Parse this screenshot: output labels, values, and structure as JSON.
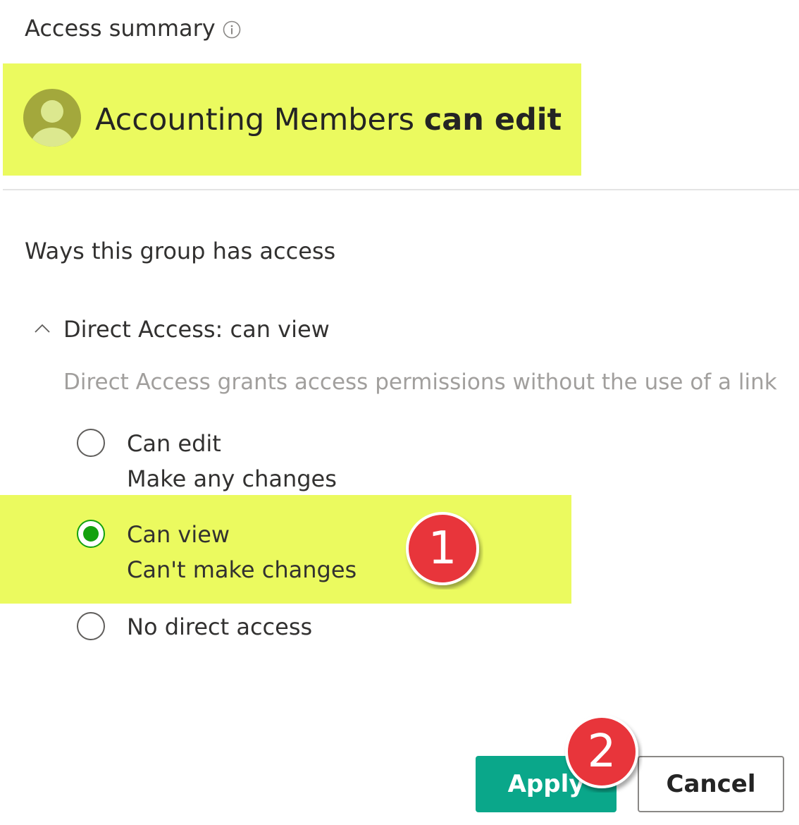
{
  "header": {
    "title": "Access summary",
    "info_icon": "info-icon"
  },
  "summary": {
    "avatar_icon": "person-avatar-icon",
    "group_name": "Accounting Members",
    "permission": "can edit"
  },
  "ways_section": {
    "heading": "Ways this group has access"
  },
  "direct_access": {
    "chevron_icon": "chevron-up-icon",
    "title": "Direct Access: can view",
    "description": "Direct Access grants access permissions without the use of a link",
    "options": [
      {
        "label": "Can edit",
        "sublabel": "Make any changes",
        "selected": false
      },
      {
        "label": "Can view",
        "sublabel": "Can't make changes",
        "selected": true
      },
      {
        "label": "No direct access",
        "selected": false
      }
    ]
  },
  "annotations": {
    "badge_1": "1",
    "badge_2": "2"
  },
  "buttons": {
    "apply": "Apply",
    "cancel": "Cancel"
  },
  "colors": {
    "highlight": "#ebfa5f",
    "accent": "#0aa78a",
    "radio_selected": "#13a10e",
    "badge": "#e8343b",
    "avatar": "#a3a83c"
  }
}
